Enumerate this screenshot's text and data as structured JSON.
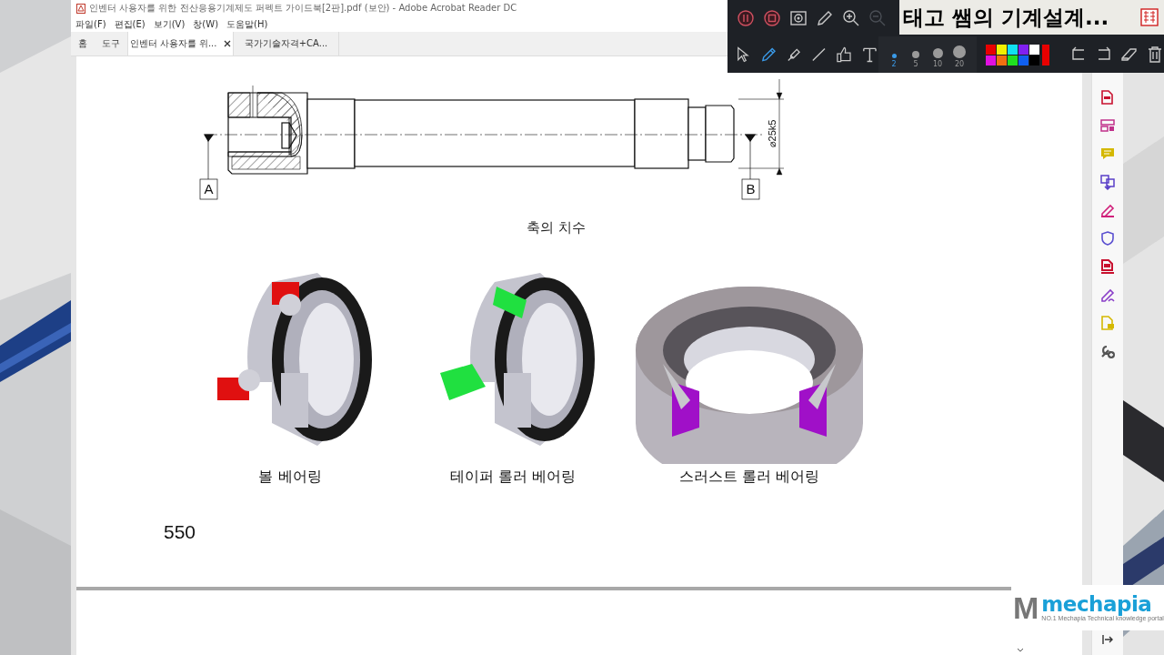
{
  "window": {
    "title": "인벤터 사용자를 위한 전산응용기계제도 퍼펙트 가이드북[2판].pdf (보안) - Adobe Acrobat Reader DC"
  },
  "menu": [
    "파일(F)",
    "편집(E)",
    "보기(V)",
    "창(W)",
    "도움말(H)"
  ],
  "tabs": [
    {
      "label": "홈",
      "kind": "nav",
      "selected": false
    },
    {
      "label": "도구",
      "kind": "nav",
      "selected": false
    },
    {
      "label": "인벤터 사용자를 위...",
      "kind": "doc",
      "selected": true
    },
    {
      "label": "국가기술자격+CA...",
      "kind": "doc",
      "selected": false
    }
  ],
  "document": {
    "datums": [
      "A",
      "B"
    ],
    "dimension": "⌀25k5",
    "drawing_caption": "축의 치수",
    "bearings": [
      {
        "kind": "ball",
        "caption": "볼 베어링"
      },
      {
        "kind": "taper",
        "caption": "테이퍼 롤러 베어링"
      },
      {
        "kind": "thrust",
        "caption": "스러스트 롤러 베어링"
      }
    ],
    "page_number": "550"
  },
  "sidebar_tools": [
    {
      "color": "#c8102e"
    },
    {
      "color": "#c0308a"
    },
    {
      "color": "#d4b800"
    },
    {
      "color": "#5a3fc8"
    },
    {
      "color": "#d0207a"
    },
    {
      "color": "#5a4fd0"
    },
    {
      "color": "#c8102e"
    },
    {
      "color": "#8a3fc8"
    },
    {
      "color": "#d4b800"
    },
    {
      "color": "#555555"
    }
  ],
  "recorder": {
    "banner": "태고 쌤의 기계설계...",
    "zoom_out_disabled": true,
    "drawing_tools": [
      {
        "kind": "select",
        "selected": false
      },
      {
        "kind": "pen",
        "selected": true
      },
      {
        "kind": "highlighter",
        "selected": false
      },
      {
        "kind": "line",
        "selected": false
      },
      {
        "kind": "stamp",
        "selected": false
      },
      {
        "kind": "text",
        "selected": false
      }
    ],
    "pen_sizes": [
      {
        "label": "2",
        "selected": true
      },
      {
        "label": "5",
        "selected": false
      },
      {
        "label": "10",
        "selected": false
      },
      {
        "label": "20",
        "selected": false
      }
    ],
    "palette": [
      {
        "color": "#e80000"
      },
      {
        "color": "#f0f000"
      },
      {
        "color": "#10e0f0"
      },
      {
        "color": "#8020f0"
      },
      {
        "color": "#ffffff"
      },
      {
        "color": "#e010e0"
      },
      {
        "color": "#f07010"
      },
      {
        "color": "#20e020"
      },
      {
        "color": "#1060f0"
      },
      {
        "color": "#000000"
      }
    ],
    "current_color": {
      "color": "#e80000"
    }
  },
  "logo": {
    "mark": "M",
    "name": "mechapia",
    "tagline": "NO.1 Mechapia Technical knowledge portal"
  }
}
